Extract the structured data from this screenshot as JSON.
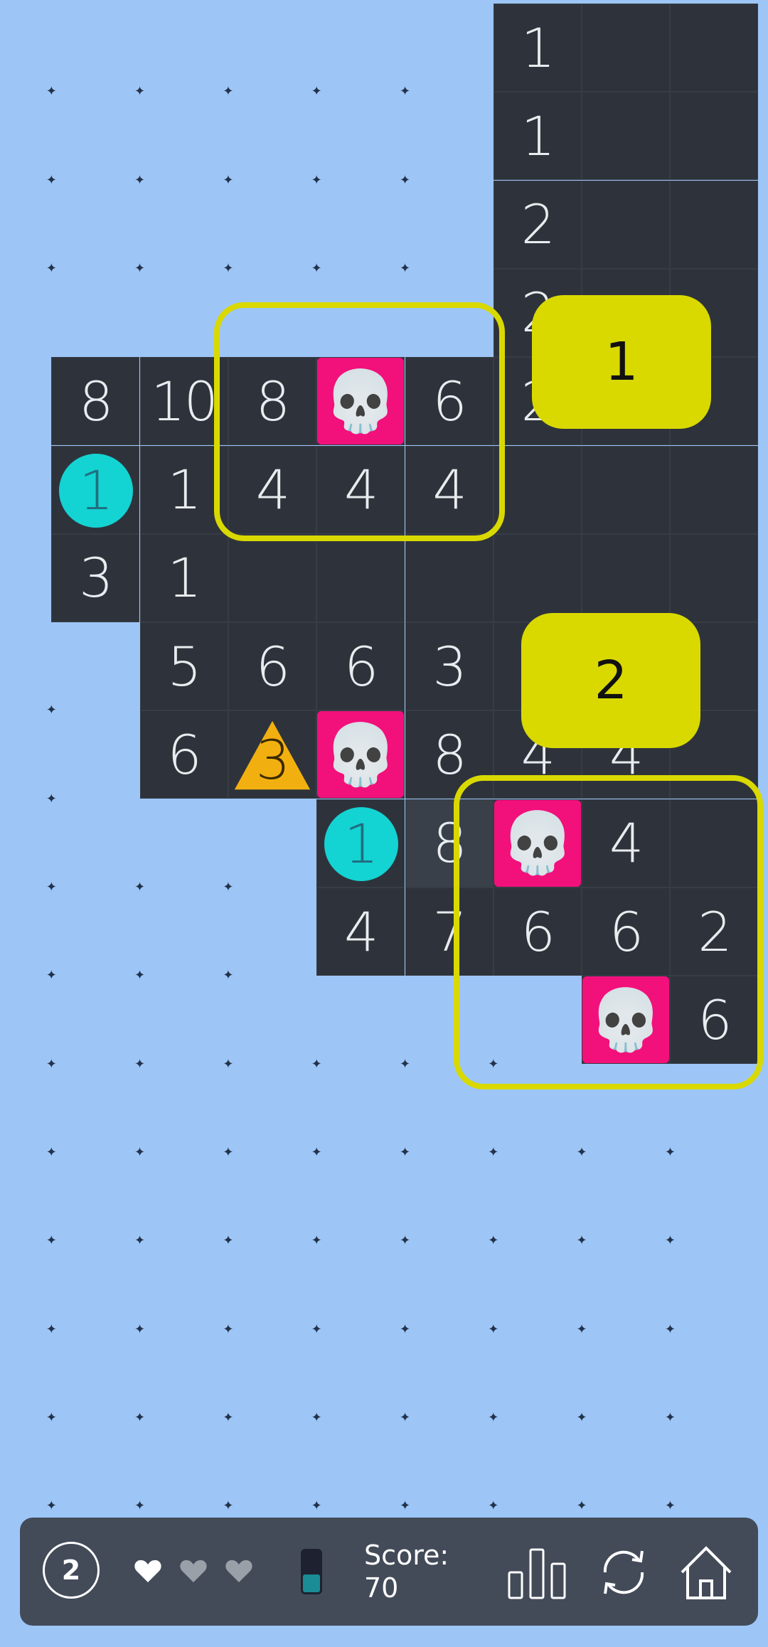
{
  "board": {
    "rows": [
      [
        "H",
        "H",
        "H",
        "H",
        "H",
        "H",
        "1",
        "R",
        "R"
      ],
      [
        "H",
        "H",
        "H",
        "H",
        "H",
        "H",
        "1",
        "R",
        "R"
      ],
      [
        "H",
        "H",
        "H",
        "H",
        "H",
        "H",
        "2",
        "R",
        "R"
      ],
      [
        "H",
        "H",
        "H",
        "H",
        "H",
        "H",
        "2",
        "R",
        "R"
      ],
      [
        "H",
        "8",
        "10",
        "8",
        "S",
        "6",
        "2",
        "R",
        "R"
      ],
      [
        "H",
        "C1",
        "1",
        "4",
        "4",
        "4",
        "R",
        "R",
        "R"
      ],
      [
        "H",
        "3",
        "1",
        "R",
        "R",
        "R",
        "R",
        "R",
        "R"
      ],
      [
        "H",
        "H",
        "5",
        "6",
        "6",
        "3",
        "R",
        "R",
        "R"
      ],
      [
        "H",
        "H",
        "6",
        "T3",
        "S",
        "8",
        "4",
        "4",
        "R"
      ],
      [
        "H",
        "H",
        "H",
        "H",
        "C1",
        "L8",
        "S",
        "4",
        "R"
      ],
      [
        "H",
        "H",
        "H",
        "H",
        "4",
        "7",
        "6",
        "6",
        "2"
      ],
      [
        "H",
        "H",
        "H",
        "H",
        "H",
        "H",
        "H",
        "S",
        "6"
      ],
      [
        "H",
        "H",
        "H",
        "H",
        "H",
        "H",
        "H",
        "H",
        "H"
      ],
      [
        "H",
        "H",
        "H",
        "H",
        "H",
        "H",
        "H",
        "H",
        "H"
      ],
      [
        "H",
        "H",
        "H",
        "H",
        "H",
        "H",
        "H",
        "H",
        "H"
      ],
      [
        "H",
        "H",
        "H",
        "H",
        "H",
        "H",
        "H",
        "H",
        "H"
      ],
      [
        "H",
        "H",
        "H",
        "H",
        "H",
        "H",
        "H",
        "H",
        "H"
      ],
      [
        "H",
        "H",
        "H",
        "H",
        "H",
        "H",
        "H",
        "H",
        "H"
      ]
    ],
    "skull_icon": "skull-icon",
    "colors": {
      "hidden": "#9dc6f7",
      "revealed": "#2e333b",
      "skull_bg": "#f2107b",
      "circle": "#14d3d3",
      "triangle": "#f2b010",
      "highlight": "#d9d900"
    }
  },
  "callouts": [
    {
      "label": "1"
    },
    {
      "label": "2"
    }
  ],
  "bottom_bar": {
    "level": "2",
    "lives": [
      "heart-full",
      "heart-empty",
      "heart-empty"
    ],
    "battery_icon": "battery-icon",
    "score_label": "Score:",
    "score_value": "70",
    "stats_icon": "stats-icon",
    "restart_icon": "restart-icon",
    "home_icon": "home-icon"
  }
}
